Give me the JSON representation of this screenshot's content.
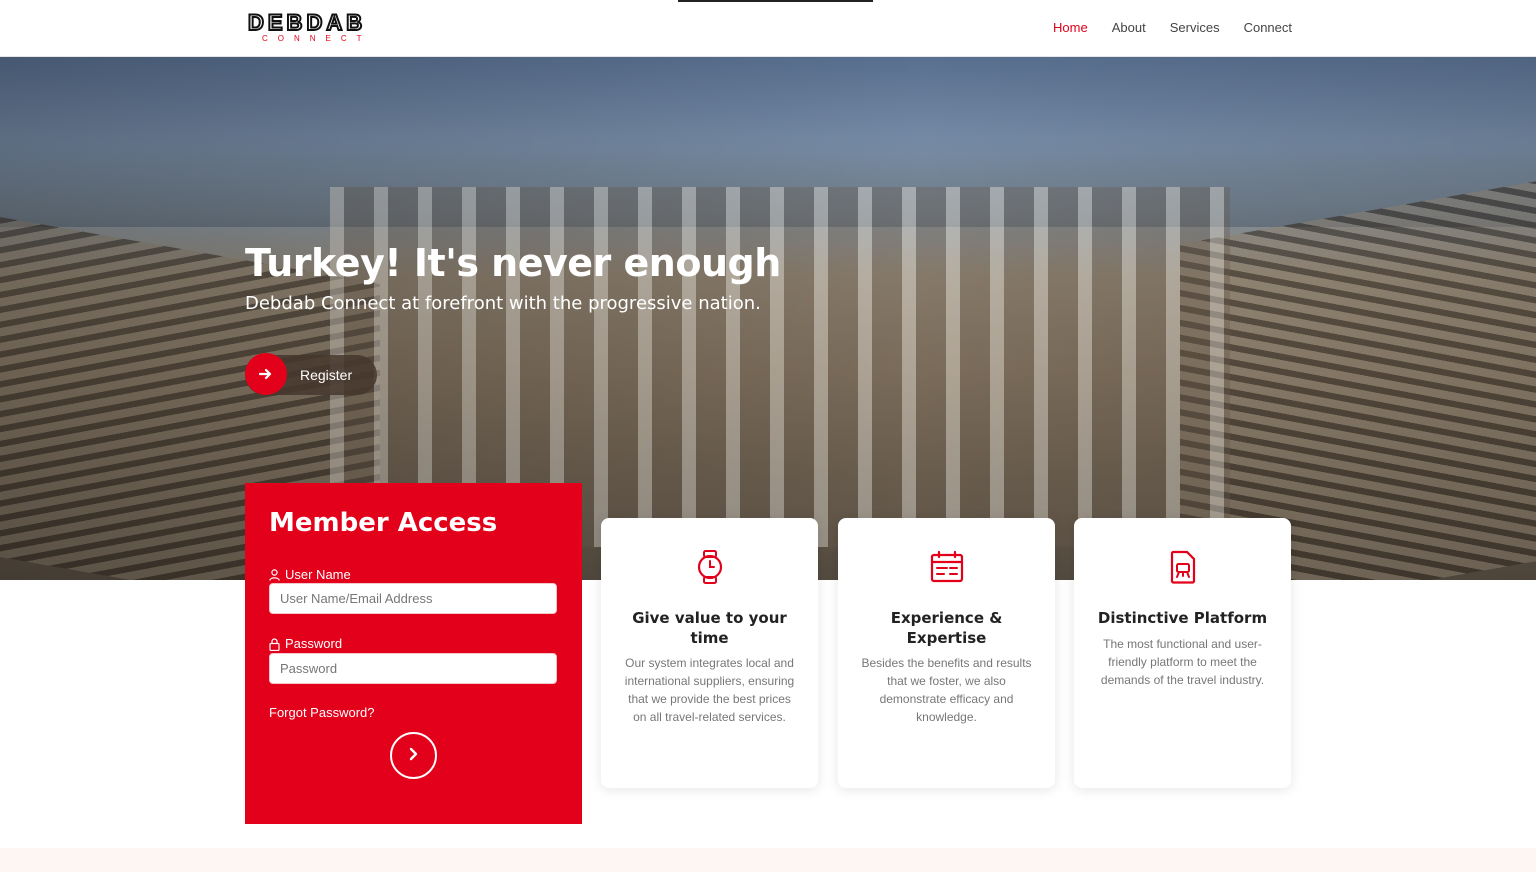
{
  "brand": {
    "logo_main": "DEBDAB",
    "logo_sub": "CONNECT",
    "accent_color": "#e2001a"
  },
  "nav": {
    "items": [
      {
        "label": "Home",
        "active": true
      },
      {
        "label": "About",
        "active": false
      },
      {
        "label": "Services",
        "active": false
      },
      {
        "label": "Connect",
        "active": false
      }
    ]
  },
  "hero": {
    "title": "Turkey! It's never enough",
    "subtitle": "Debdab Connect at forefront with the progressive nation.",
    "register_label": "Register",
    "register_icon": "arrow-right-icon"
  },
  "member": {
    "title": "Member Access",
    "username_label": "User Name",
    "username_placeholder": "User Name/Email Address",
    "username_icon": "user-icon",
    "password_label": "Password",
    "password_placeholder": "Password",
    "password_icon": "lock-icon",
    "forgot_label": "Forgot Password?",
    "submit_icon": "chevron-right-icon"
  },
  "cards": [
    {
      "icon": "watch-icon",
      "title": "Give value to your time",
      "text": "Our system integrates local and international suppliers, ensuring that we provide the best prices on all travel-related services."
    },
    {
      "icon": "calendar-icon",
      "title": "Experience & Expertise",
      "text": "Besides the benefits and results that we foster, we also demonstrate efficacy and knowledge."
    },
    {
      "icon": "platform-icon",
      "title": "Distinctive Platform",
      "text": "The most functional and user-friendly platform to meet the demands of the travel industry."
    }
  ]
}
